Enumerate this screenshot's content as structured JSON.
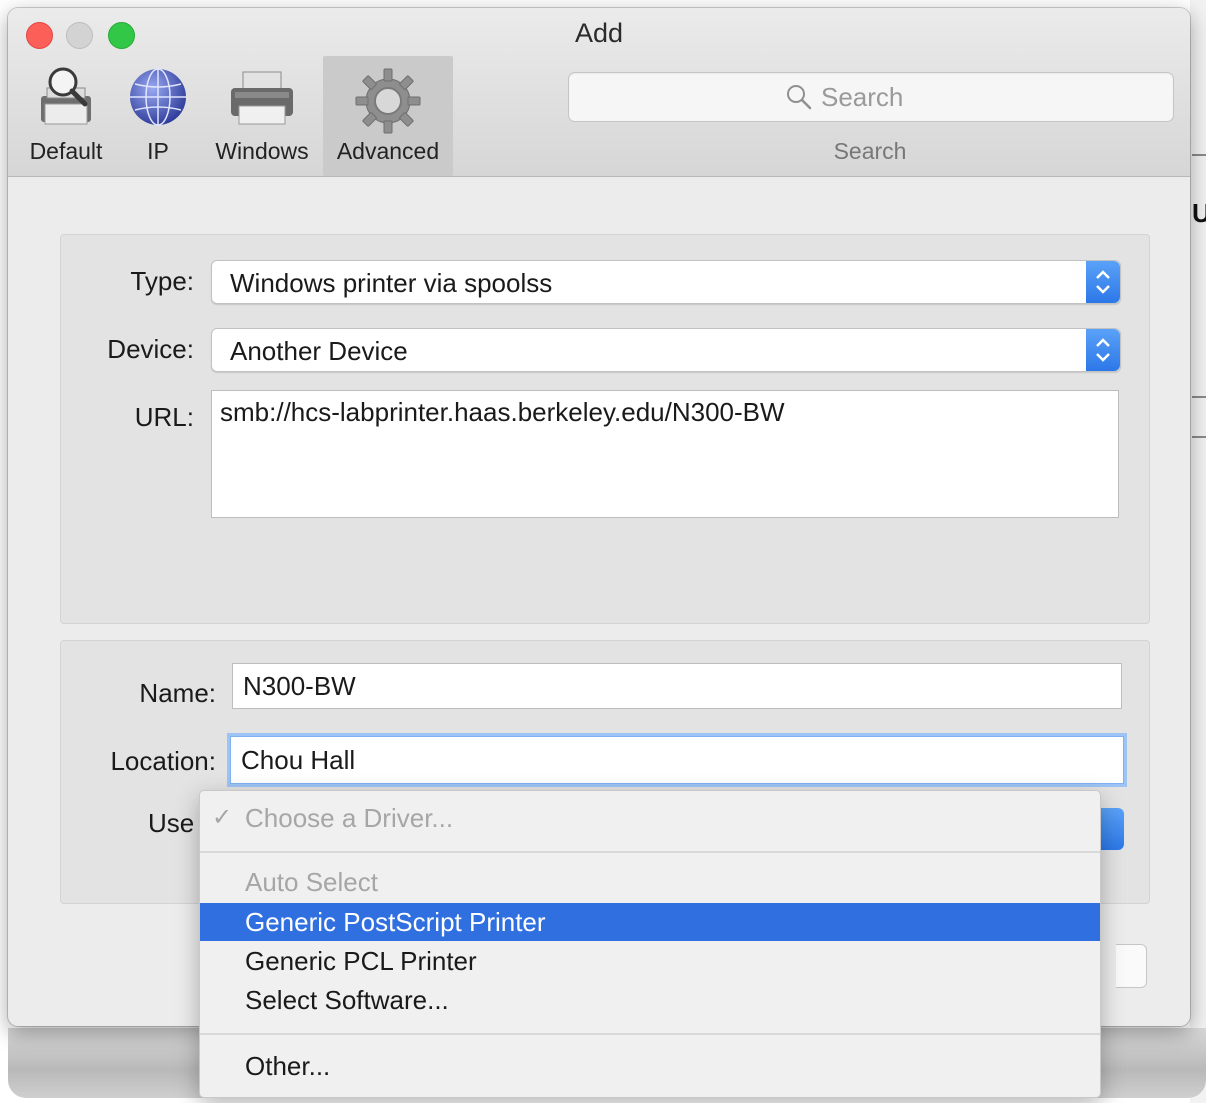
{
  "window": {
    "title": "Add"
  },
  "toolbar": {
    "items": [
      {
        "label": "Default",
        "icon": "default-printer-icon"
      },
      {
        "label": "IP",
        "icon": "globe-icon"
      },
      {
        "label": "Windows",
        "icon": "windows-printer-icon"
      },
      {
        "label": "Advanced",
        "icon": "gear-icon",
        "selected": true
      }
    ],
    "search": {
      "placeholder": "Search",
      "caption": "Search"
    }
  },
  "form": {
    "type": {
      "label": "Type:",
      "value": "Windows printer via spoolss"
    },
    "device": {
      "label": "Device:",
      "value": "Another Device"
    },
    "url": {
      "label": "URL:",
      "value": "smb://hcs-labprinter.haas.berkeley.edu/N300-BW"
    },
    "name": {
      "label": "Name:",
      "value": "N300-BW"
    },
    "location": {
      "label": "Location:",
      "value": "Chou Hall"
    },
    "use": {
      "label": "Use"
    }
  },
  "driver_menu": {
    "items": [
      {
        "label": "Choose a Driver...",
        "checked": true,
        "disabled": true
      },
      {
        "label": "Auto Select",
        "disabled": true
      },
      {
        "label": "Generic PostScript Printer",
        "highlighted": true
      },
      {
        "label": "Generic PCL Printer"
      },
      {
        "label": "Select Software..."
      },
      {
        "label": "Other..."
      }
    ]
  },
  "colors": {
    "accent": "#2f6fe0",
    "close": "#fc5f57",
    "maximize": "#33c748",
    "focus_ring": "#9ec4f5"
  }
}
